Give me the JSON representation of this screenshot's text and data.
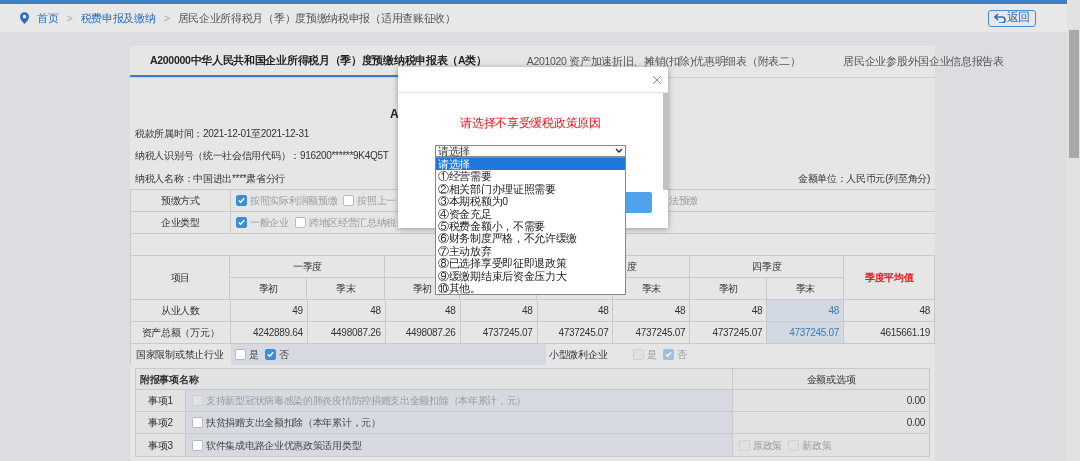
{
  "breadcrumb": [
    {
      "label": "首页",
      "kind": "home"
    },
    {
      "label": "税费申报及缴纳",
      "kind": "link",
      "separator": ">"
    },
    {
      "label": "居民企业所得税月（季）度预缴纳税申报（适用查账征收）",
      "kind": "current",
      "separator": ">"
    }
  ],
  "back_button": "返回",
  "tabs": [
    {
      "label": "A200000中华人民共和国企业所得税月（季）度预缴纳税申报表（A类）",
      "selected": true
    },
    {
      "label": "A201020 资产加速折旧、摊销(扣除)优惠明细表（附表二）",
      "selected": false
    },
    {
      "label": "居民企业参股外国企业信息报告表",
      "selected": false
    }
  ],
  "form_title": "A",
  "info": {
    "period": "税款所属时间：2021-12-01至2021-12-31",
    "taxpayer_id": "纳税人识别号（统一社会信用代码）：916200******9K4Q5T",
    "taxpayer_name": "纳税人名称：中国进出****肃省分行",
    "unit": "金额单位：人民币元(列至角分)"
  },
  "option_rows": [
    {
      "label": "预缴方式",
      "options": [
        {
          "label": "按照实际利润额预缴",
          "checked": true
        },
        {
          "label": "按照上一",
          "checked": false
        }
      ],
      "trailing": "法预缴"
    },
    {
      "label": "企业类型",
      "options": [
        {
          "label": "一般企业",
          "checked": true
        },
        {
          "label": "跨地区经营汇总纳税",
          "checked": false
        }
      ]
    }
  ],
  "main_table": {
    "item_header": "项目",
    "quarters": [
      {
        "label": "一季度",
        "start": "季初",
        "end": "季末"
      },
      {
        "start": "季初"
      },
      {
        "label": "度",
        "end": "季末"
      },
      {
        "label": "四季度",
        "start": "季初",
        "end": "季末"
      }
    ],
    "average_header": "季度平均值",
    "rows": [
      {
        "label": "从业人数",
        "cells": [
          {
            "value": "49",
            "editable": false
          },
          {
            "value": "48",
            "editable": false
          },
          {
            "value": "48",
            "editable": false
          },
          {
            "value": "48",
            "editable": false
          },
          {
            "value": "48",
            "editable": false
          },
          {
            "value": "48",
            "editable": false
          },
          {
            "value": "48",
            "editable": false
          },
          {
            "value": "48",
            "editable": true
          },
          {
            "value": "48",
            "editable": false
          }
        ]
      },
      {
        "label": "资产总额（万元）",
        "cells": [
          {
            "value": "4242889.64",
            "editable": false
          },
          {
            "value": "4498087.26",
            "editable": false
          },
          {
            "value": "4498087.26",
            "editable": false
          },
          {
            "value": "4737245.07",
            "editable": false
          },
          {
            "value": "4737245.07",
            "editable": false
          },
          {
            "value": "4737245.07",
            "editable": false
          },
          {
            "value": "4737245.07",
            "editable": false
          },
          {
            "value": "4737245.07",
            "editable": true
          },
          {
            "value": "4615661.19",
            "editable": false
          }
        ]
      }
    ]
  },
  "restricted_row": {
    "label": "国家限制或禁止行业",
    "options": [
      {
        "label": "是",
        "checked": false,
        "disabled": false
      },
      {
        "label": "否",
        "checked": true,
        "disabled": false
      }
    ],
    "small_label": "小型微利企业",
    "small_options": [
      {
        "label": "是",
        "checked": false,
        "disabled": true
      },
      {
        "label": "否",
        "checked": true,
        "disabled": true
      }
    ]
  },
  "attachments": {
    "header": "附报事项名称",
    "value_header": "金额或选项",
    "items": [
      {
        "label": "事项1",
        "text": "支持新型冠状病毒感染的肺炎疫情防控捐赠支出全额扣除（本年累计，元）",
        "checked": false,
        "disabled": true,
        "kind": "amount",
        "value": "0.00"
      },
      {
        "label": "事项2",
        "text": "扶贫捐赠支出全额扣除（本年累计，元）",
        "checked": false,
        "disabled": false,
        "kind": "amount",
        "value": "0.00"
      },
      {
        "label": "事项3",
        "text": "软件集成电路企业优惠政策适用类型",
        "checked": false,
        "disabled": false,
        "kind": "choices",
        "choices": [
          {
            "label": "原政策",
            "checked": false,
            "disabled": true
          },
          {
            "label": "新政策",
            "checked": false,
            "disabled": true
          }
        ]
      }
    ]
  },
  "modal": {
    "title": "请选择不享受缓税政策原因",
    "select": {
      "value": "请选择",
      "options": [
        {
          "label": "请选择",
          "selected": true
        },
        {
          "label": "①经营需要",
          "selected": false
        },
        {
          "label": "②相关部门办理证照需要",
          "selected": false
        },
        {
          "label": "③本期税额为0",
          "selected": false
        },
        {
          "label": "④资金充足",
          "selected": false
        },
        {
          "label": "⑤税费金额小，不需要",
          "selected": false
        },
        {
          "label": "⑥财务制度严格，不允许缓缴",
          "selected": false
        },
        {
          "label": "⑦主动放弃",
          "selected": false
        },
        {
          "label": "⑧已选择享受即征即退政策",
          "selected": false
        },
        {
          "label": "⑨缓缴期结束后资金压力大",
          "selected": false
        },
        {
          "label": "⑩其他。",
          "selected": false
        }
      ]
    }
  }
}
